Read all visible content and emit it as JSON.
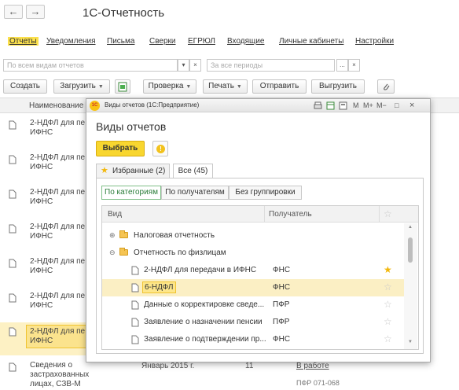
{
  "app": {
    "back_label": "←",
    "forward_label": "→",
    "title": "1С-Отчетность"
  },
  "menu": {
    "items": [
      {
        "label": "Отчеты",
        "active": true
      },
      {
        "label": "Уведомления"
      },
      {
        "label": "Письма"
      },
      {
        "label": "Сверки"
      },
      {
        "label": "ЕГРЮЛ"
      },
      {
        "label": "Входящие"
      },
      {
        "label": "Личные кабинеты"
      },
      {
        "label": "Настройки"
      }
    ]
  },
  "filters": {
    "kinds_placeholder": "По всем видам отчетов",
    "periods_placeholder": "За все периоды",
    "dropdown_glyph": "▾",
    "clear_glyph": "×",
    "more_glyph": "..."
  },
  "toolbar": {
    "create": "Создать",
    "load": "Загрузить",
    "check": "Проверка",
    "print": "Печать",
    "send": "Отправить",
    "export": "Выгрузить"
  },
  "list": {
    "header_name": "Наименование",
    "rows": [
      {
        "name": "2-НДФЛ для пе ИФНС"
      },
      {
        "name": "2-НДФЛ для пе ИФНС"
      },
      {
        "name": "2-НДФЛ для пе ИФНС"
      },
      {
        "name": "2-НДФЛ для пе ИФНС"
      },
      {
        "name": "2-НДФЛ для пе ИФНС"
      },
      {
        "name": "2-НДФЛ для пе ИФНС"
      },
      {
        "name": "2-НДФЛ для пе ИФНС",
        "selected": true
      },
      {
        "name": "Сведения о застрахованных лицах, СЗВ-М"
      }
    ],
    "peek_date": "Январь 2015 г.",
    "peek_num": "11",
    "peek_status": "В работе",
    "peek_reg": "ПФР 071-068"
  },
  "modal": {
    "window_title": "Виды отчетов (1С:Предприятие)",
    "logo_text": "1С",
    "heading": "Виды отчетов",
    "select_button": "Выбрать",
    "info_glyph": "!",
    "tabs": {
      "favorites": "Избранные (2)",
      "all": "Все (45)"
    },
    "grouping": {
      "by_category": "По категориям",
      "by_recipient": "По получателям",
      "none": "Без группировки"
    },
    "columns": {
      "kind": "Вид",
      "recipient": "Получатель"
    },
    "groups": [
      {
        "label": "Налоговая отчетность",
        "expander": "⊕"
      },
      {
        "label": "Отчетность по физлицам",
        "expander": "⊖"
      }
    ],
    "rows": [
      {
        "kind": "2-НДФЛ для передачи в ИФНС",
        "recipient": "ФНС",
        "favorite": true
      },
      {
        "kind": "6-НДФЛ",
        "recipient": "ФНС",
        "favorite": false,
        "selected": true
      },
      {
        "kind": "Данные о корректировке сведе...",
        "recipient": "ПФР",
        "favorite": false
      },
      {
        "kind": "Заявление о назначении пенсии",
        "recipient": "ПФР",
        "favorite": false
      },
      {
        "kind": "Заявление о подтверждении пр...",
        "recipient": "ФНС",
        "favorite": false
      }
    ],
    "window_controls": {
      "m": "M",
      "mplus": "M+",
      "mminus": "M−",
      "maximize": "□",
      "close": "×"
    },
    "scroll_up": "▲",
    "scroll_down": "▼"
  },
  "colors": {
    "accent_yellow": "#f8d62f",
    "selection": "#fbefc4",
    "active_green": "#2b7d3a"
  }
}
